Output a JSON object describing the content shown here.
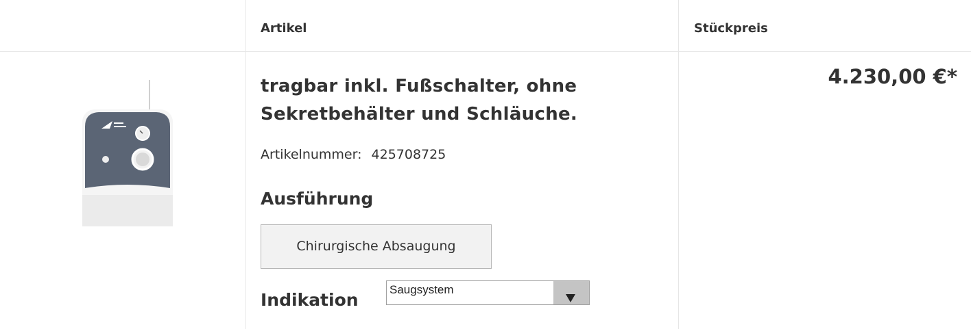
{
  "header": {
    "col_artikel": "Artikel",
    "col_stueckpreis": "Stückpreis"
  },
  "product": {
    "title_line1": "tragbar inkl. Fußschalter, ohne",
    "title_line2": "Sekretbehälter und Schläuche.",
    "article_number_label": "Artikelnummer:",
    "article_number_value": "425708725",
    "image_icon": "suction-device-image"
  },
  "variant": {
    "section_title": "Ausführung",
    "selected_label": "Chirurgische Absaugung"
  },
  "indication": {
    "section_title": "Indikation",
    "selected_value": "Saugsystem"
  },
  "price": {
    "unit_price": "4.230,00 €*"
  },
  "colors": {
    "text": "#333333",
    "border": "#e6e6e6",
    "panel": "#5b6575",
    "button_bg": "#f2f2f2"
  }
}
